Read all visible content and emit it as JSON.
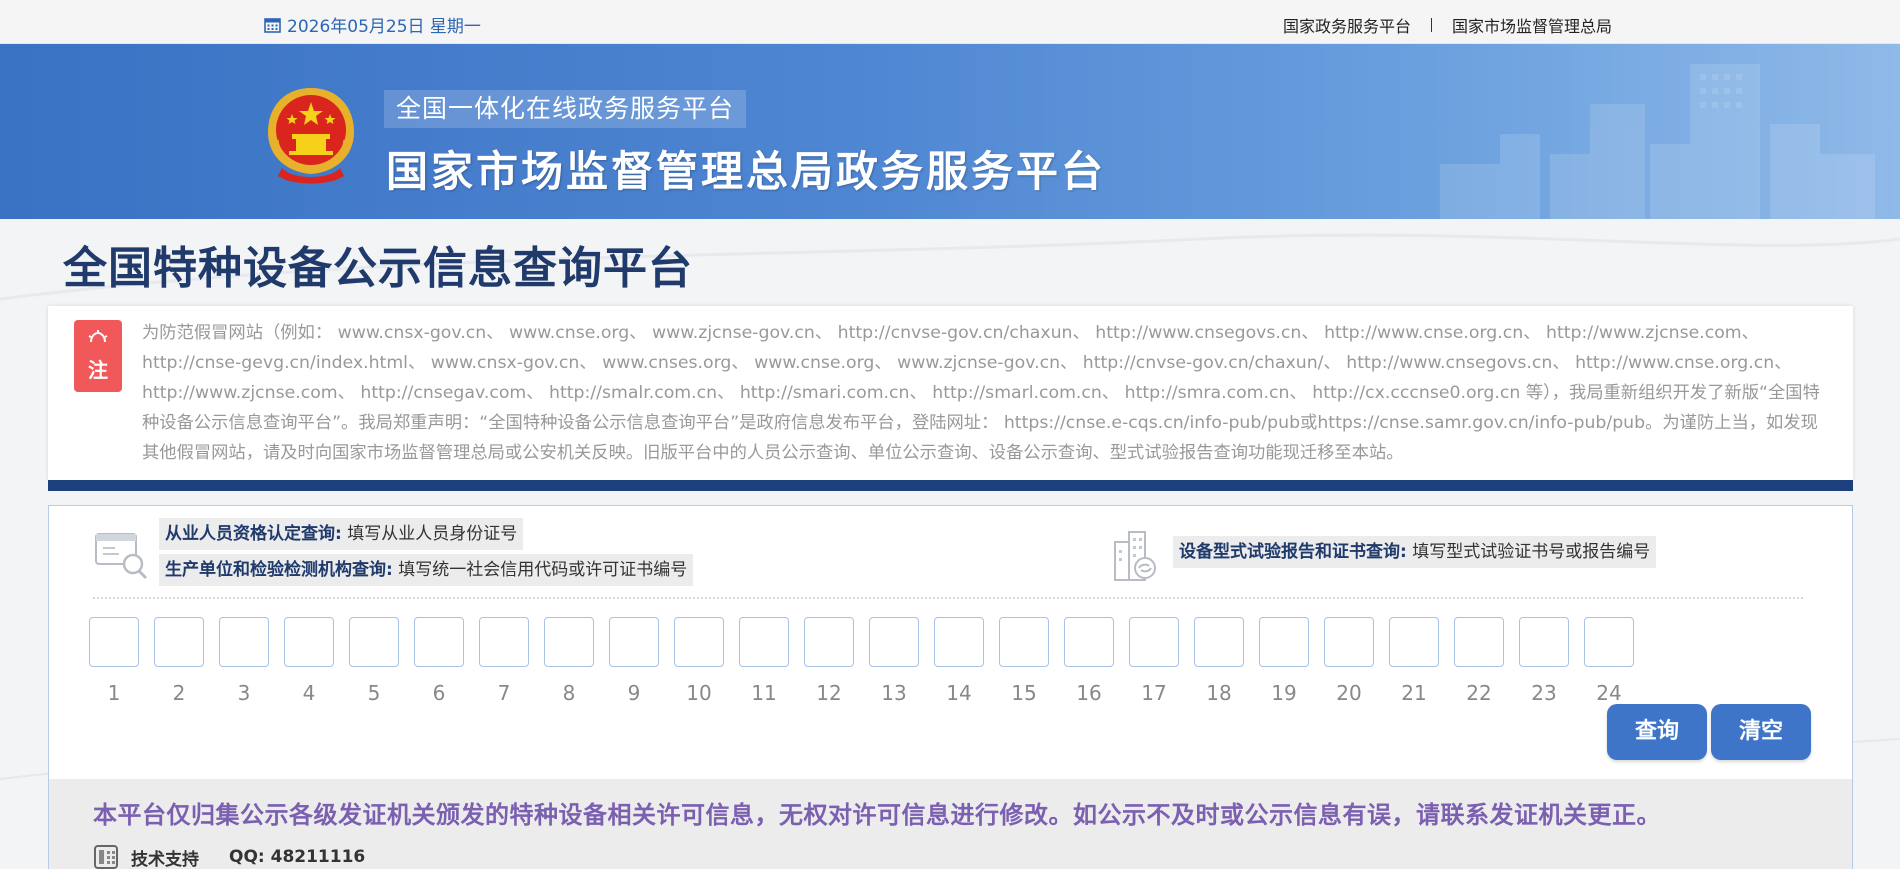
{
  "topbar": {
    "date": "2026年05月25日 星期一",
    "links": [
      "国家政务服务平台",
      "国家市场监督管理总局"
    ]
  },
  "banner": {
    "subtitle": "全国一体化在线政务服务平台",
    "title": "国家市场监督管理总局政务服务平台"
  },
  "page_title": "全国特种设备公示信息查询平台",
  "notice": {
    "badge": "注",
    "text": "为防范假冒网站（例如： www.cnsx-gov.cn、 www.cnse.org、 www.zjcnse-gov.cn、 http://cnvse-gov.cn/chaxun、 http://www.cnsegovs.cn、 http://www.cnse.org.cn、 http://www.zjcnse.com、 http://cnse-gevg.cn/index.html、 www.cnsx-gov.cn、 www.cnses.org、 www.cnse.org、 www.zjcnse-gov.cn、 http://cnvse-gov.cn/chaxun/、 http://www.cnsegovs.cn、 http://www.cnse.org.cn、 http://www.zjcnse.com、 http://cnsegav.com、 http://smalr.com.cn、 http://smari.com.cn、 http://smarl.com.cn、 http://smra.com.cn、 http://cx.cccnse0.org.cn 等），我局重新组织开发了新版“全国特种设备公示信息查询平台”。我局郑重声明：“全国特种设备公示信息查询平台”是政府信息发布平台，登陆网址： https://cnse.e-cqs.cn/info-pub/pub或https://cnse.samr.gov.cn/info-pub/pub。为谨防上当，如发现其他假冒网站，请及时向国家市场监督管理总局或公安机关反映。旧版平台中的人员公示查询、单位公示查询、设备公示查询、型式试验报告查询功能现迁移至本站。"
  },
  "search": {
    "person_label": "从业人员资格认定查询:",
    "person_hint": "填写从业人员身份证号",
    "org_label": "生产单位和检验检测机构查询:",
    "org_hint": "填写统一社会信用代码或许可证书编号",
    "device_label": "设备型式试验报告和证书查询:",
    "device_hint": "填写型式试验证书号或报告编号",
    "cell_numbers": [
      "1",
      "2",
      "3",
      "4",
      "5",
      "6",
      "7",
      "8",
      "9",
      "10",
      "11",
      "12",
      "13",
      "14",
      "15",
      "16",
      "17",
      "18",
      "19",
      "20",
      "21",
      "22",
      "23",
      "24"
    ],
    "query_button": "查询",
    "clear_button": "清空"
  },
  "footer": {
    "disclaimer": "本平台仅归集公示各级发证机关颁发的特种设备相关许可信息，无权对许可信息进行修改。如公示不及时或公示信息有误，请联系发证机关更正。",
    "support_label": "技术支持",
    "qq_label": "QQ: 48211116"
  },
  "colors": {
    "primary": "#3f75c9",
    "title": "#1f3a6b",
    "notice_badge": "#f0585a",
    "disclaimer": "#7b5fb0"
  }
}
